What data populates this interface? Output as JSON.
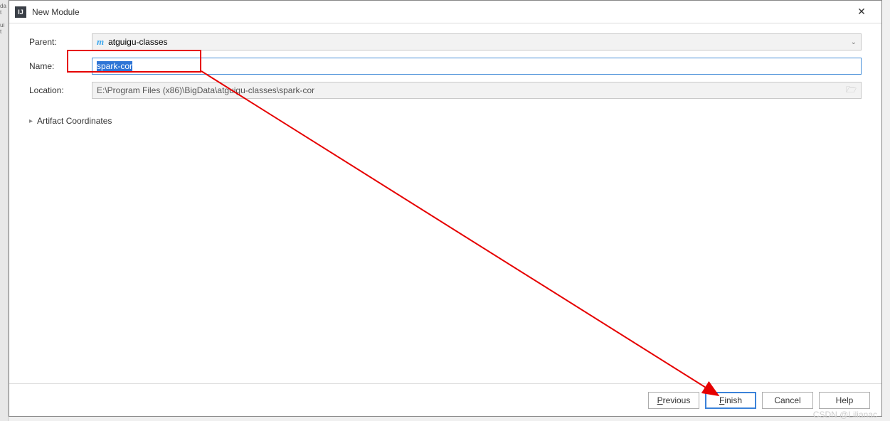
{
  "titlebar": {
    "title": "New Module"
  },
  "form": {
    "parent_label": "Parent:",
    "parent_icon": "m",
    "parent_value": "atguigu-classes",
    "name_label": "Name:",
    "name_value": "spark-cor",
    "location_label": "Location:",
    "location_value": "E:\\Program Files (x86)\\BigData\\atguigu-classes\\spark-cor",
    "artifact_label": "Artifact Coordinates"
  },
  "buttons": {
    "previous": "Previous",
    "finish": "Finish",
    "cancel": "Cancel",
    "help": "Help"
  },
  "watermark": "CSDN @Lilianac"
}
